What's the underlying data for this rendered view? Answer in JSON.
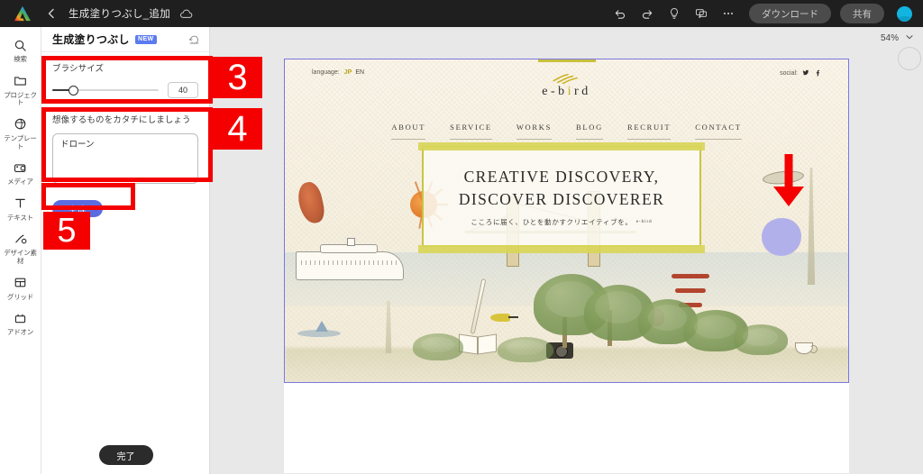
{
  "topbar": {
    "logo": "adobe-logo",
    "back": "back-chevron-icon",
    "title": "生成塗りつぶし_追加",
    "cloud": "cloud-icon",
    "undo": "undo-icon",
    "redo": "redo-icon",
    "ideas": "lightbulb-icon",
    "comment": "comment-icon",
    "more": "more-horizontal-icon",
    "download_label": "ダウンロード",
    "share_label": "共有",
    "avatar": "user-avatar"
  },
  "rail": {
    "items": [
      {
        "icon": "search-icon",
        "label": "検索"
      },
      {
        "icon": "folder-icon",
        "label": "プロジェクト"
      },
      {
        "icon": "template-icon",
        "label": "テンプレート"
      },
      {
        "icon": "media-icon",
        "label": "メディア"
      },
      {
        "icon": "text-icon",
        "label": "テキスト"
      },
      {
        "icon": "design-asset-icon",
        "label": "デザイン素材"
      },
      {
        "icon": "grid-icon",
        "label": "グリッド"
      },
      {
        "icon": "addon-icon",
        "label": "アドオン"
      }
    ]
  },
  "panel": {
    "title": "生成塗りつぶし",
    "new_badge": "NEW",
    "reset_icon": "reset-icon",
    "brush_size_label": "ブラシサイズ",
    "brush_size_value": "40",
    "brush_size_percent": 20,
    "prompt_label": "想像するものをカタチにしましょう",
    "prompt_value": "ドローン",
    "generate_label": "生成",
    "done_label": "完了"
  },
  "annotations": [
    {
      "number": "3",
      "target": "brush-size-section"
    },
    {
      "number": "4",
      "target": "prompt-section"
    },
    {
      "number": "5",
      "target": "generate-button"
    }
  ],
  "canvas": {
    "zoom_level": "54%",
    "zoom_chevron": "chevron-down-icon",
    "brush_selection_color": "#b2b0ea",
    "arrow_color": "#f40000"
  },
  "artboard": {
    "language_label": "language:",
    "language_active": "JP",
    "language_other": "EN",
    "social_label": "social:",
    "social_icons": [
      "twitter-icon",
      "facebook-icon"
    ],
    "brand_name_pre": "e-b",
    "brand_name_accent": "i",
    "brand_name_post": "rd",
    "nav": [
      "ABOUT",
      "SERVICE",
      "WORKS",
      "BLOG",
      "RECRUIT",
      "CONTACT"
    ],
    "headline_line1": "CREATIVE DISCOVERY,",
    "headline_line2": "DISCOVER DISCOVERER",
    "subtitle": "こころに届く、ひとを動かすクリエイティブを。",
    "subtitle_mark": "e-bird"
  }
}
